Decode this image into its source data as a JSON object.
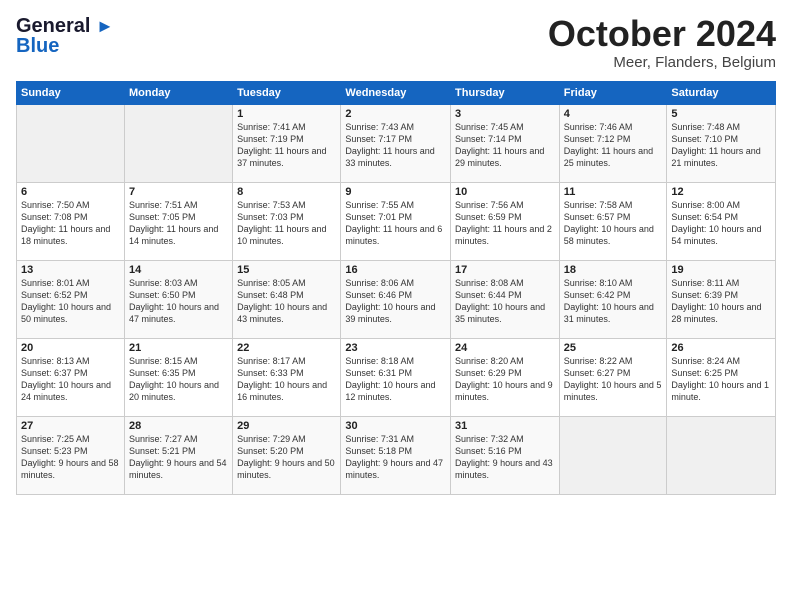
{
  "header": {
    "logo_line1": "General",
    "logo_line2": "Blue",
    "month": "October 2024",
    "location": "Meer, Flanders, Belgium"
  },
  "weekdays": [
    "Sunday",
    "Monday",
    "Tuesday",
    "Wednesday",
    "Thursday",
    "Friday",
    "Saturday"
  ],
  "weeks": [
    [
      {
        "day": "",
        "info": ""
      },
      {
        "day": "",
        "info": ""
      },
      {
        "day": "1",
        "info": "Sunrise: 7:41 AM\nSunset: 7:19 PM\nDaylight: 11 hours and 37 minutes."
      },
      {
        "day": "2",
        "info": "Sunrise: 7:43 AM\nSunset: 7:17 PM\nDaylight: 11 hours and 33 minutes."
      },
      {
        "day": "3",
        "info": "Sunrise: 7:45 AM\nSunset: 7:14 PM\nDaylight: 11 hours and 29 minutes."
      },
      {
        "day": "4",
        "info": "Sunrise: 7:46 AM\nSunset: 7:12 PM\nDaylight: 11 hours and 25 minutes."
      },
      {
        "day": "5",
        "info": "Sunrise: 7:48 AM\nSunset: 7:10 PM\nDaylight: 11 hours and 21 minutes."
      }
    ],
    [
      {
        "day": "6",
        "info": "Sunrise: 7:50 AM\nSunset: 7:08 PM\nDaylight: 11 hours and 18 minutes."
      },
      {
        "day": "7",
        "info": "Sunrise: 7:51 AM\nSunset: 7:05 PM\nDaylight: 11 hours and 14 minutes."
      },
      {
        "day": "8",
        "info": "Sunrise: 7:53 AM\nSunset: 7:03 PM\nDaylight: 11 hours and 10 minutes."
      },
      {
        "day": "9",
        "info": "Sunrise: 7:55 AM\nSunset: 7:01 PM\nDaylight: 11 hours and 6 minutes."
      },
      {
        "day": "10",
        "info": "Sunrise: 7:56 AM\nSunset: 6:59 PM\nDaylight: 11 hours and 2 minutes."
      },
      {
        "day": "11",
        "info": "Sunrise: 7:58 AM\nSunset: 6:57 PM\nDaylight: 10 hours and 58 minutes."
      },
      {
        "day": "12",
        "info": "Sunrise: 8:00 AM\nSunset: 6:54 PM\nDaylight: 10 hours and 54 minutes."
      }
    ],
    [
      {
        "day": "13",
        "info": "Sunrise: 8:01 AM\nSunset: 6:52 PM\nDaylight: 10 hours and 50 minutes."
      },
      {
        "day": "14",
        "info": "Sunrise: 8:03 AM\nSunset: 6:50 PM\nDaylight: 10 hours and 47 minutes."
      },
      {
        "day": "15",
        "info": "Sunrise: 8:05 AM\nSunset: 6:48 PM\nDaylight: 10 hours and 43 minutes."
      },
      {
        "day": "16",
        "info": "Sunrise: 8:06 AM\nSunset: 6:46 PM\nDaylight: 10 hours and 39 minutes."
      },
      {
        "day": "17",
        "info": "Sunrise: 8:08 AM\nSunset: 6:44 PM\nDaylight: 10 hours and 35 minutes."
      },
      {
        "day": "18",
        "info": "Sunrise: 8:10 AM\nSunset: 6:42 PM\nDaylight: 10 hours and 31 minutes."
      },
      {
        "day": "19",
        "info": "Sunrise: 8:11 AM\nSunset: 6:39 PM\nDaylight: 10 hours and 28 minutes."
      }
    ],
    [
      {
        "day": "20",
        "info": "Sunrise: 8:13 AM\nSunset: 6:37 PM\nDaylight: 10 hours and 24 minutes."
      },
      {
        "day": "21",
        "info": "Sunrise: 8:15 AM\nSunset: 6:35 PM\nDaylight: 10 hours and 20 minutes."
      },
      {
        "day": "22",
        "info": "Sunrise: 8:17 AM\nSunset: 6:33 PM\nDaylight: 10 hours and 16 minutes."
      },
      {
        "day": "23",
        "info": "Sunrise: 8:18 AM\nSunset: 6:31 PM\nDaylight: 10 hours and 12 minutes."
      },
      {
        "day": "24",
        "info": "Sunrise: 8:20 AM\nSunset: 6:29 PM\nDaylight: 10 hours and 9 minutes."
      },
      {
        "day": "25",
        "info": "Sunrise: 8:22 AM\nSunset: 6:27 PM\nDaylight: 10 hours and 5 minutes."
      },
      {
        "day": "26",
        "info": "Sunrise: 8:24 AM\nSunset: 6:25 PM\nDaylight: 10 hours and 1 minute."
      }
    ],
    [
      {
        "day": "27",
        "info": "Sunrise: 7:25 AM\nSunset: 5:23 PM\nDaylight: 9 hours and 58 minutes."
      },
      {
        "day": "28",
        "info": "Sunrise: 7:27 AM\nSunset: 5:21 PM\nDaylight: 9 hours and 54 minutes."
      },
      {
        "day": "29",
        "info": "Sunrise: 7:29 AM\nSunset: 5:20 PM\nDaylight: 9 hours and 50 minutes."
      },
      {
        "day": "30",
        "info": "Sunrise: 7:31 AM\nSunset: 5:18 PM\nDaylight: 9 hours and 47 minutes."
      },
      {
        "day": "31",
        "info": "Sunrise: 7:32 AM\nSunset: 5:16 PM\nDaylight: 9 hours and 43 minutes."
      },
      {
        "day": "",
        "info": ""
      },
      {
        "day": "",
        "info": ""
      }
    ]
  ]
}
